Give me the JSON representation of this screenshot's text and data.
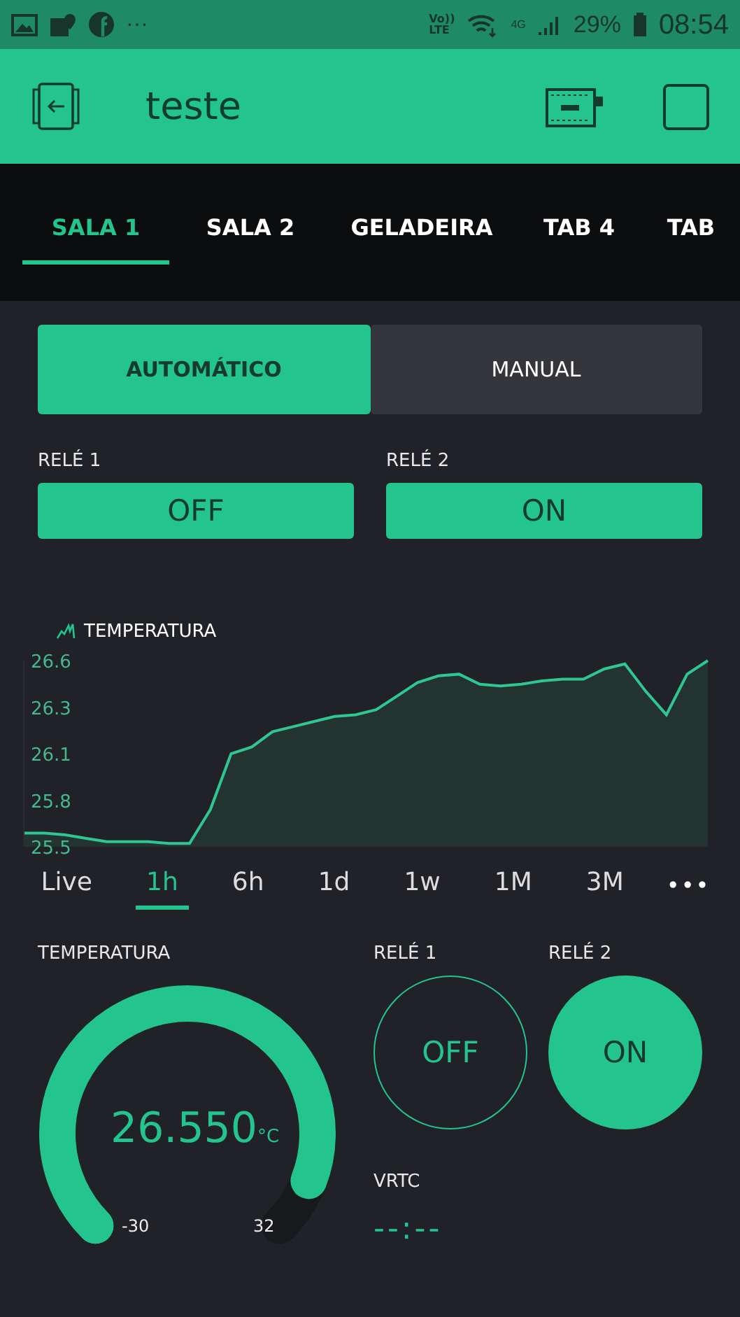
{
  "status_bar": {
    "more": "···",
    "volte_top": "Vo))",
    "volte_bottom": "LTE",
    "network": "4G",
    "battery": "29%",
    "time": "08:54"
  },
  "header": {
    "title": "teste"
  },
  "tabs": [
    {
      "label": "SALA 1",
      "selected": true
    },
    {
      "label": "SALA 2",
      "selected": false
    },
    {
      "label": "GELADEIRA",
      "selected": false
    },
    {
      "label": "TAB 4",
      "selected": false
    },
    {
      "label": "TAB",
      "selected": false
    }
  ],
  "mode": [
    {
      "label": "AUTOMÁTICO",
      "selected": true
    },
    {
      "label": "MANUAL",
      "selected": false
    }
  ],
  "relay_buttons": [
    {
      "label": "RELÉ 1",
      "value": "OFF"
    },
    {
      "label": "RELÉ 2",
      "value": "ON"
    }
  ],
  "chart": {
    "chart_data": {
      "type": "area",
      "ylim": [
        25.5,
        26.6
      ],
      "yticks": [
        {
          "value": 25.5,
          "label": "25.5"
        },
        {
          "value": 25.775,
          "label": "25.8"
        },
        {
          "value": 26.05,
          "label": "26.1"
        },
        {
          "value": 26.325,
          "label": "26.3"
        },
        {
          "value": 26.6,
          "label": "26.6"
        }
      ],
      "series": [
        {
          "name": "TEMPERATURA",
          "color": "#2fc693",
          "values": [
            25.58,
            25.58,
            25.57,
            25.55,
            25.53,
            25.53,
            25.53,
            25.52,
            25.52,
            25.72,
            26.05,
            26.09,
            26.18,
            26.21,
            26.24,
            26.27,
            26.28,
            26.31,
            26.39,
            26.47,
            26.51,
            26.52,
            26.46,
            26.45,
            26.46,
            26.48,
            26.49,
            26.49,
            26.55,
            26.58,
            26.42,
            26.28,
            26.52,
            26.6
          ]
        }
      ]
    },
    "periods": [
      {
        "label": "Live",
        "selected": false
      },
      {
        "label": "1h",
        "selected": true
      },
      {
        "label": "6h",
        "selected": false
      },
      {
        "label": "1d",
        "selected": false
      },
      {
        "label": "1w",
        "selected": false
      },
      {
        "label": "1M",
        "selected": false
      },
      {
        "label": "3M",
        "selected": false
      }
    ],
    "more": "•••"
  },
  "gauge": {
    "label": "TEMPERATURA",
    "value": "26.550",
    "unit": "°C",
    "min": "-30",
    "max": "32"
  },
  "relays": [
    {
      "label": "RELÉ 1",
      "value": "OFF",
      "on": false
    },
    {
      "label": "RELÉ 2",
      "value": "ON",
      "on": true
    }
  ],
  "vrtc": {
    "label": "VRTC",
    "value": "--:--"
  }
}
